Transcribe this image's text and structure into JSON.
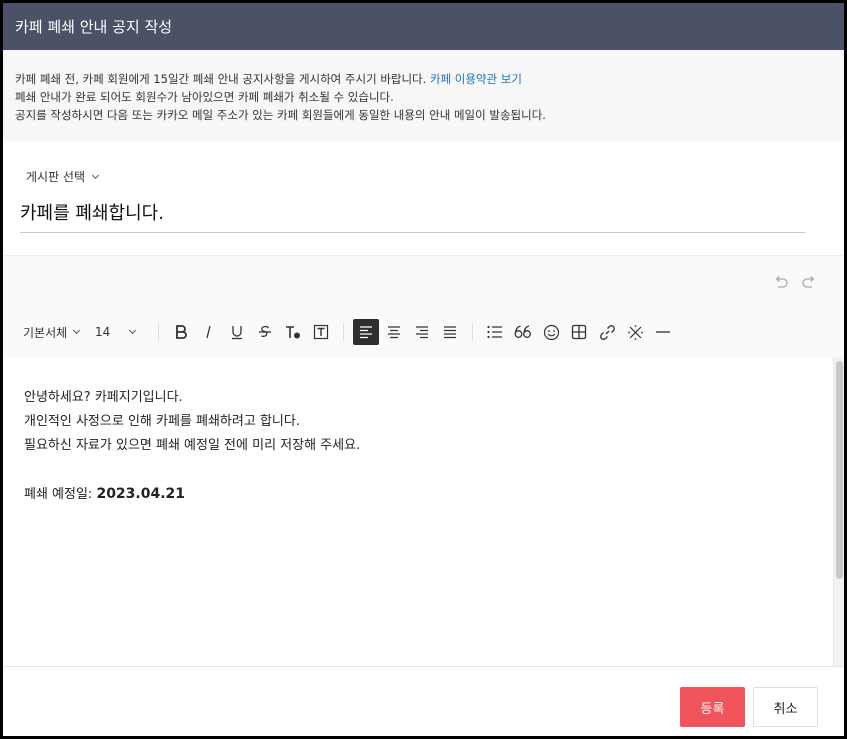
{
  "dialog": {
    "title": "카페 폐쇄 안내 공지 작성"
  },
  "notice": {
    "line1": "카페 폐쇄 전, 카페 회원에게 15일간 폐쇄 안내 공지사항을 게시하여 주시기 바랍니다. ",
    "terms_link": "카페 이용약관 보기",
    "line2": "폐쇄 안내가 완료 되어도 회원수가 남아있으면 카페 폐쇄가 취소될 수 있습니다.",
    "line3": "공지를 작성하시면 다음 또는 카카오 메일 주소가 있는 카페 회원들에게 동일한 내용의 안내 메일이 발송됩니다."
  },
  "board_select": {
    "label": "게시판 선택"
  },
  "title_field": {
    "value": "카페를 폐쇄합니다."
  },
  "toolbar": {
    "font_family": "기본서체",
    "font_size": "14",
    "icons": [
      "bold-icon",
      "italic-icon",
      "underline-icon",
      "strikethrough-icon",
      "text-color-icon",
      "text-background-icon",
      "align-left-icon",
      "align-center-icon",
      "align-right-icon",
      "align-justify-icon",
      "bullet-list-icon",
      "quote-icon",
      "emoji-icon",
      "table-icon",
      "link-icon",
      "clear-format-icon",
      "horizontal-rule-icon"
    ]
  },
  "editor": {
    "line1": "안녕하세요? 카페지기입니다.",
    "line2": "개인적인 사정으로 인해 카페를 폐쇄하려고 합니다.",
    "line3": "필요하신 자료가 있으면 폐쇄 예정일 전에 미리 저장해 주세요.",
    "date_label": "폐쇄 예정일: ",
    "date_value": "2023.04.21"
  },
  "footer": {
    "submit_label": "등록",
    "cancel_label": "취소"
  },
  "colors": {
    "titlebar": "#4b5166",
    "submit": "#f2545b",
    "link": "#1a73c8"
  }
}
